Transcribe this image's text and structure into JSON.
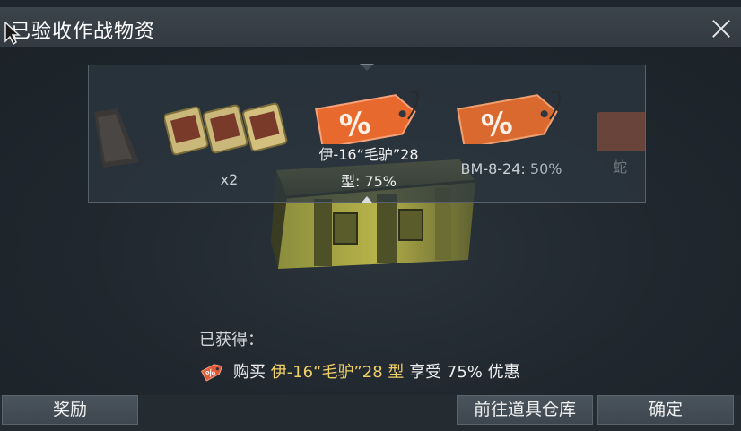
{
  "window": {
    "title": "已验收作战物资"
  },
  "carousel": {
    "items": [
      {
        "caption": ""
      },
      {
        "caption": "x2"
      },
      {
        "caption_line1": "伊-16“毛驴”28",
        "caption_line2": "型: 75%"
      },
      {
        "caption_name": "BM-8-24: ",
        "caption_value": "50%"
      },
      {
        "caption_partial": "蛇"
      }
    ]
  },
  "obtained": {
    "label": "已获得：",
    "prefix": "购买 ",
    "highlight": "伊-16“毛驴”28 型",
    "suffix": " 享受 75% 优惠"
  },
  "buttons": {
    "rewards": "奖励",
    "go_to_warehouse": "前往道具仓库",
    "confirm": "确定"
  },
  "colors": {
    "highlight": "#f0cf66",
    "coupon_orange": "#e8692e",
    "panel_bg": "#2d3740"
  }
}
